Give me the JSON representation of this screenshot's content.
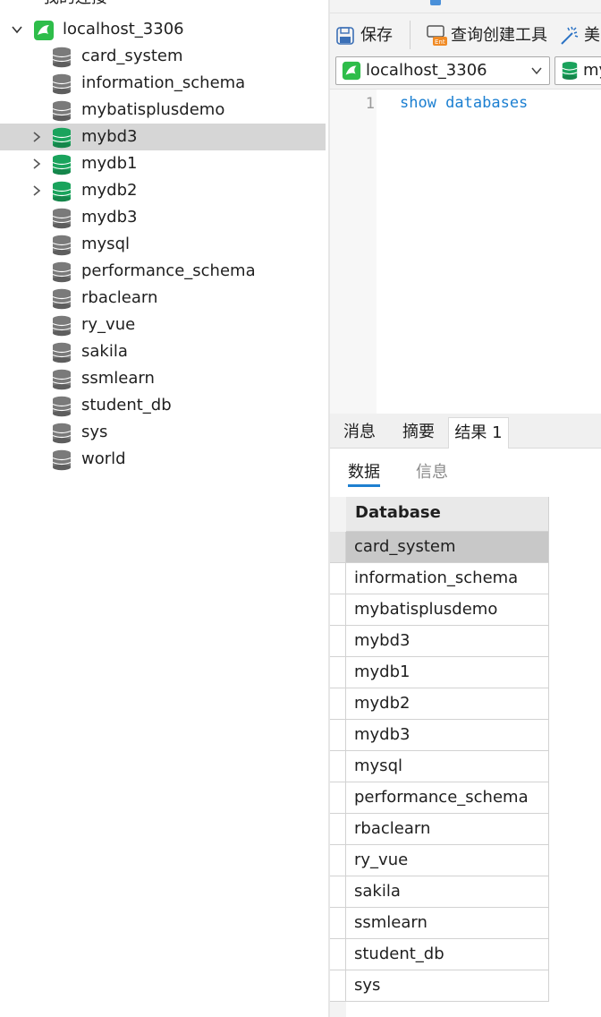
{
  "tree": {
    "header_text": "我的连接",
    "connection": {
      "label": "localhost_3306",
      "expanded": true
    },
    "databases": [
      {
        "label": "card_system",
        "active": false,
        "expandable": false
      },
      {
        "label": "information_schema",
        "active": false,
        "expandable": false
      },
      {
        "label": "mybatisplusdemo",
        "active": false,
        "expandable": false
      },
      {
        "label": "mybd3",
        "active": true,
        "expandable": true,
        "selected": true
      },
      {
        "label": "mydb1",
        "active": true,
        "expandable": true
      },
      {
        "label": "mydb2",
        "active": true,
        "expandable": true
      },
      {
        "label": "mydb3",
        "active": false,
        "expandable": false
      },
      {
        "label": "mysql",
        "active": false,
        "expandable": false
      },
      {
        "label": "performance_schema",
        "active": false,
        "expandable": false
      },
      {
        "label": "rbaclearn",
        "active": false,
        "expandable": false
      },
      {
        "label": "ry_vue",
        "active": false,
        "expandable": false
      },
      {
        "label": "sakila",
        "active": false,
        "expandable": false
      },
      {
        "label": "ssmlearn",
        "active": false,
        "expandable": false
      },
      {
        "label": "student_db",
        "active": false,
        "expandable": false
      },
      {
        "label": "sys",
        "active": false,
        "expandable": false
      },
      {
        "label": "world",
        "active": false,
        "expandable": false
      }
    ]
  },
  "toolbar": {
    "save_label": "保存",
    "query_builder_label": "查询创建工具",
    "beautify_label": "美"
  },
  "selectors": {
    "connection_value": "localhost_3306",
    "database_value": "my"
  },
  "editor": {
    "line_number": "1",
    "code": "show databases"
  },
  "result_tabs": [
    {
      "label": "消息",
      "active": false
    },
    {
      "label": "摘要",
      "active": false
    },
    {
      "label": "结果 1",
      "active": true
    }
  ],
  "sub_tabs": [
    {
      "label": "数据",
      "active": true
    },
    {
      "label": "信息",
      "active": false
    }
  ],
  "grid": {
    "column_header": "Database",
    "rows": [
      "card_system",
      "information_schema",
      "mybatisplusdemo",
      "mybd3",
      "mydb1",
      "mydb2",
      "mydb3",
      "mysql",
      "performance_schema",
      "rbaclearn",
      "ry_vue",
      "sakila",
      "ssmlearn",
      "student_db",
      "sys"
    ],
    "selected_row": 0
  },
  "colors": {
    "active_db": "#1aa35c",
    "inactive_db": "#7a7a7a",
    "accent": "#1e7fd0",
    "keyword": "#1b7fd1",
    "connection_green": "#2ebd4a"
  }
}
